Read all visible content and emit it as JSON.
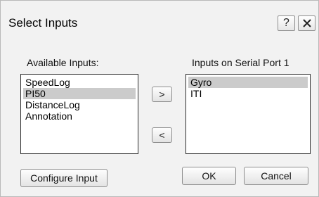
{
  "dialog": {
    "title": "Select Inputs",
    "help_label": "?",
    "close_icon": "close-icon"
  },
  "available": {
    "label": "Available Inputs:",
    "items": [
      "SpeedLog",
      "PI50",
      "DistanceLog",
      "Annotation"
    ],
    "selected": "PI50"
  },
  "port": {
    "label": "Inputs on Serial Port 1",
    "items": [
      "Gyro",
      "ITI"
    ],
    "selected": "Gyro"
  },
  "buttons": {
    "add_label": ">",
    "remove_label": "<",
    "configure_label": "Configure Input",
    "ok_label": "OK",
    "cancel_label": "Cancel"
  },
  "colors": {
    "dialog_bg": "#f2f2f2",
    "selection": "#cbcbcb"
  }
}
